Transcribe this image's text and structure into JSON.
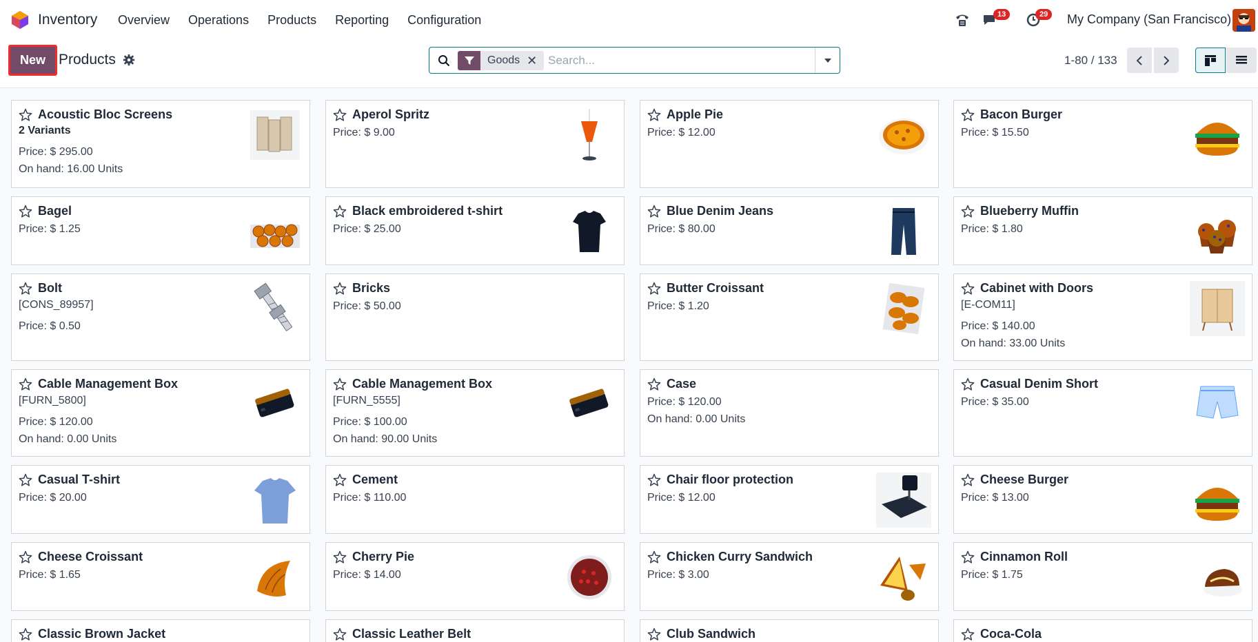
{
  "app": {
    "name": "Inventory"
  },
  "menu": [
    "Overview",
    "Operations",
    "Products",
    "Reporting",
    "Configuration"
  ],
  "systray": {
    "chat_count": "13",
    "activity_count": "29",
    "company": "My Company (San Francisco)"
  },
  "control": {
    "new_label": "New",
    "breadcrumb": "Products",
    "facet": "Goods",
    "search_placeholder": "Search...",
    "pager": "1-80 / 133"
  },
  "products": [
    {
      "name": "Acoustic Bloc Screens",
      "lines": [
        {
          "t": "2 Variants",
          "bold": true
        },
        {
          "t": "Price: $ 295.00"
        },
        {
          "t": "On hand: 16.00 Units"
        }
      ],
      "img": "screens"
    },
    {
      "name": "Aperol Spritz",
      "lines": [
        {
          "t": "Price: $ 9.00"
        }
      ],
      "img": "drink"
    },
    {
      "name": "Apple Pie",
      "lines": [
        {
          "t": "Price: $ 12.00"
        }
      ],
      "img": "pie"
    },
    {
      "name": "Bacon Burger",
      "lines": [
        {
          "t": "Price: $ 15.50"
        }
      ],
      "img": "burger"
    },
    {
      "name": "Bagel",
      "lines": [
        {
          "t": "Price: $ 1.25"
        }
      ],
      "img": "bagels"
    },
    {
      "name": "Black embroidered t-shirt",
      "lines": [
        {
          "t": "Price: $ 25.00"
        }
      ],
      "img": "blackshirt"
    },
    {
      "name": "Blue Denim Jeans",
      "lines": [
        {
          "t": "Price: $ 80.00"
        }
      ],
      "img": "jeans"
    },
    {
      "name": "Blueberry Muffin",
      "lines": [
        {
          "t": "Price: $ 1.80"
        }
      ],
      "img": "muffin"
    },
    {
      "name": "Bolt",
      "lines": [
        {
          "t": "[CONS_89957]"
        },
        {
          "t": "Price: $ 0.50"
        }
      ],
      "img": "bolt"
    },
    {
      "name": "Bricks",
      "lines": [
        {
          "t": "Price: $ 50.00"
        }
      ],
      "img": ""
    },
    {
      "name": "Butter Croissant",
      "lines": [
        {
          "t": "Price: $ 1.20"
        }
      ],
      "img": "croissants"
    },
    {
      "name": "Cabinet with Doors",
      "lines": [
        {
          "t": "[E-COM11]"
        },
        {
          "t": "Price: $ 140.00"
        },
        {
          "t": "On hand: 33.00 Units"
        }
      ],
      "img": "cabinet"
    },
    {
      "name": "Cable Management Box",
      "lines": [
        {
          "t": "[FURN_5800]"
        },
        {
          "t": "Price: $ 120.00"
        },
        {
          "t": "On hand: 0.00 Units"
        }
      ],
      "img": "cablebox"
    },
    {
      "name": "Cable Management Box",
      "lines": [
        {
          "t": "[FURN_5555]"
        },
        {
          "t": "Price: $ 100.00"
        },
        {
          "t": "On hand: 90.00 Units"
        }
      ],
      "img": "cablebox"
    },
    {
      "name": "Case",
      "lines": [
        {
          "t": "Price: $ 120.00"
        },
        {
          "t": "On hand: 0.00 Units"
        }
      ],
      "img": ""
    },
    {
      "name": "Casual Denim Short",
      "lines": [
        {
          "t": "Price: $ 35.00"
        }
      ],
      "img": "shorts"
    },
    {
      "name": "Casual T-shirt",
      "lines": [
        {
          "t": "Price: $ 20.00"
        }
      ],
      "img": "blueshirt"
    },
    {
      "name": "Cement",
      "lines": [
        {
          "t": "Price: $ 110.00"
        }
      ],
      "img": ""
    },
    {
      "name": "Chair floor protection",
      "lines": [
        {
          "t": "Price: $ 12.00"
        }
      ],
      "img": "chairmat"
    },
    {
      "name": "Cheese Burger",
      "lines": [
        {
          "t": "Price: $ 13.00"
        }
      ],
      "img": "burger"
    },
    {
      "name": "Cheese Croissant",
      "lines": [
        {
          "t": "Price: $ 1.65"
        }
      ],
      "img": "croissant"
    },
    {
      "name": "Cherry Pie",
      "lines": [
        {
          "t": "Price: $ 14.00"
        }
      ],
      "img": "cherrypie"
    },
    {
      "name": "Chicken Curry Sandwich",
      "lines": [
        {
          "t": "Price: $ 3.00"
        }
      ],
      "img": "sandwich"
    },
    {
      "name": "Cinnamon Roll",
      "lines": [
        {
          "t": "Price: $ 1.75"
        }
      ],
      "img": "roll"
    },
    {
      "name": "Classic Brown Jacket",
      "lines": [],
      "img": ""
    },
    {
      "name": "Classic Leather Belt",
      "lines": [],
      "img": ""
    },
    {
      "name": "Club Sandwich",
      "lines": [],
      "img": ""
    },
    {
      "name": "Coca-Cola",
      "lines": [],
      "img": ""
    }
  ]
}
